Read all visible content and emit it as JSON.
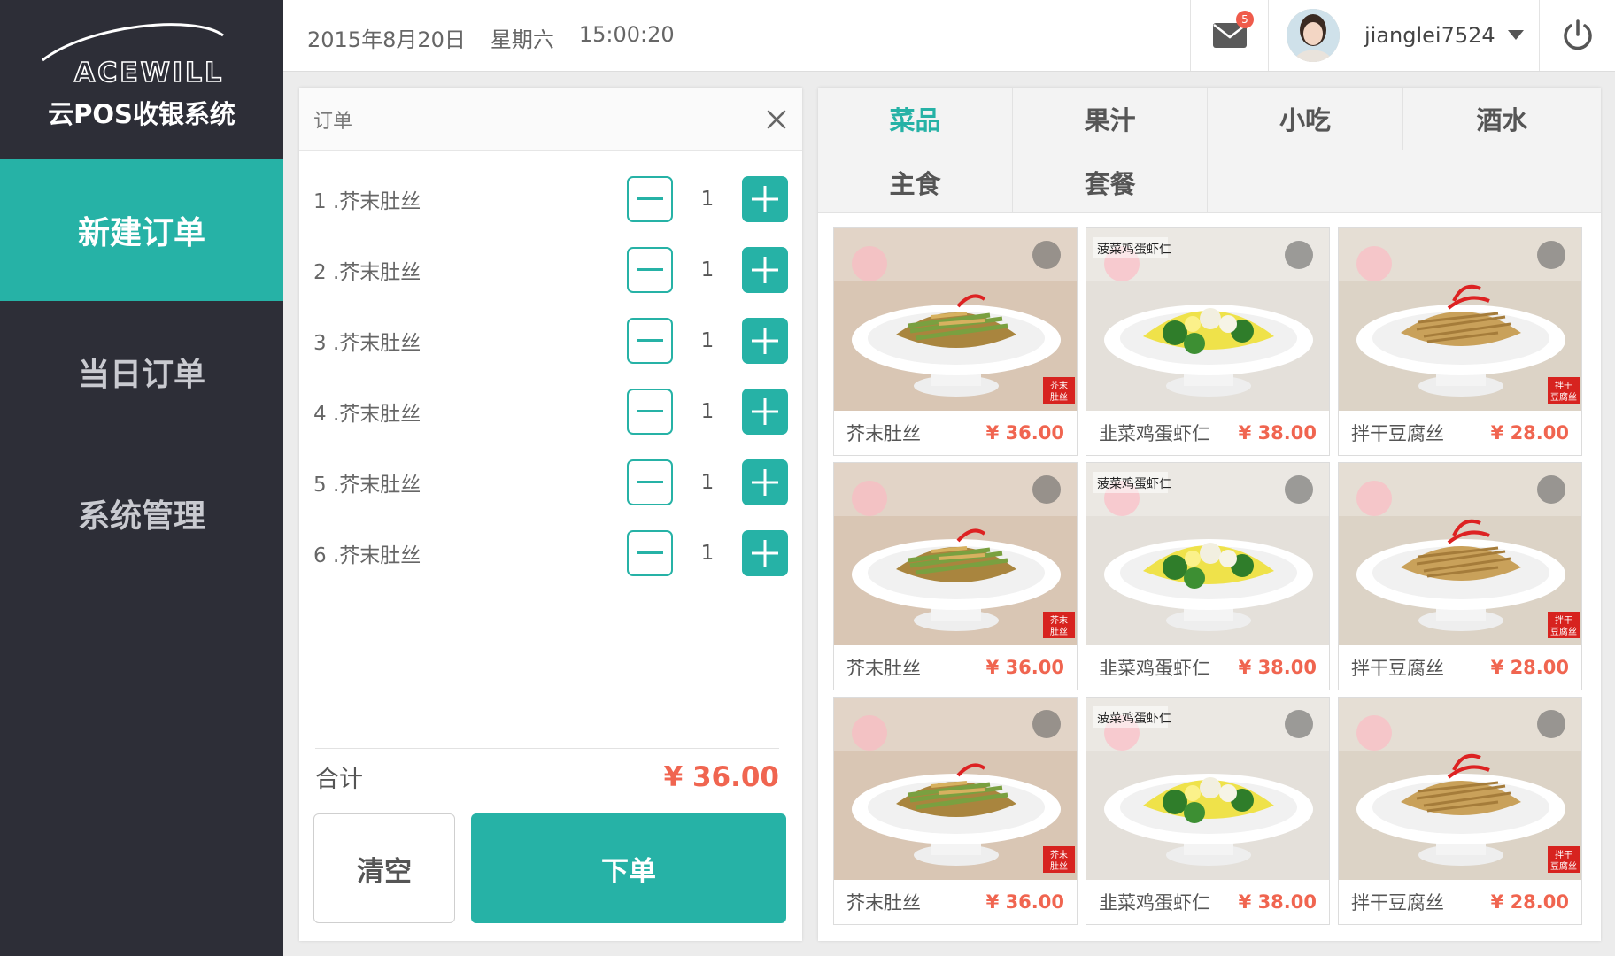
{
  "brand": {
    "logo_text": "ACEWILL",
    "subtitle": "云POS收银系统"
  },
  "sidebar": {
    "items": [
      {
        "label": "新建订单",
        "active": true
      },
      {
        "label": "当日订单",
        "active": false
      },
      {
        "label": "系统管理",
        "active": false
      }
    ]
  },
  "topbar": {
    "date": "2015年8月20日",
    "weekday": "星期六",
    "time": "15:00:20",
    "mail_count": "5",
    "username": "jianglei7524"
  },
  "order": {
    "title": "订单",
    "items": [
      {
        "name": "1 .芥末肚丝",
        "qty": "1"
      },
      {
        "name": "2 .芥末肚丝",
        "qty": "1"
      },
      {
        "name": "3 .芥末肚丝",
        "qty": "1"
      },
      {
        "name": "4 .芥末肚丝",
        "qty": "1"
      },
      {
        "name": "5 .芥末肚丝",
        "qty": "1"
      },
      {
        "name": "6 .芥末肚丝",
        "qty": "1"
      }
    ],
    "total_label": "合计",
    "total_amount": "¥ 36.00",
    "clear_label": "清空",
    "submit_label": "下单"
  },
  "menu": {
    "categories": [
      "菜品",
      "果汁",
      "小吃",
      "酒水",
      "主食",
      "套餐"
    ],
    "active_category": "菜品",
    "dishes": [
      {
        "name": "芥末肚丝",
        "price": "¥ 36.00",
        "photo_label": "芥末肚丝"
      },
      {
        "name": "韭菜鸡蛋虾仁",
        "price": "¥ 38.00",
        "photo_label": "菠菜鸡蛋虾仁"
      },
      {
        "name": "拌干豆腐丝",
        "price": "¥ 28.00",
        "photo_label": "拌干豆腐丝"
      },
      {
        "name": "芥末肚丝",
        "price": "¥ 36.00",
        "photo_label": "芥末肚丝"
      },
      {
        "name": "韭菜鸡蛋虾仁",
        "price": "¥ 38.00",
        "photo_label": "菠菜鸡蛋虾仁"
      },
      {
        "name": "拌干豆腐丝",
        "price": "¥ 28.00",
        "photo_label": "拌干豆腐丝"
      },
      {
        "name": "芥末肚丝",
        "price": "¥ 36.00",
        "photo_label": "芥末肚丝"
      },
      {
        "name": "韭菜鸡蛋虾仁",
        "price": "¥ 38.00",
        "photo_label": "菠菜鸡蛋虾仁"
      },
      {
        "name": "拌干豆腐丝",
        "price": "¥ 28.00",
        "photo_label": "拌干豆腐丝"
      }
    ]
  },
  "colors": {
    "accent": "#26b2a6",
    "sidebar_bg": "#2d2e37",
    "price": "#f06550"
  },
  "icons": [
    "mail-icon",
    "caret-down-icon",
    "power-icon",
    "close-icon",
    "minus-icon",
    "plus-icon"
  ]
}
